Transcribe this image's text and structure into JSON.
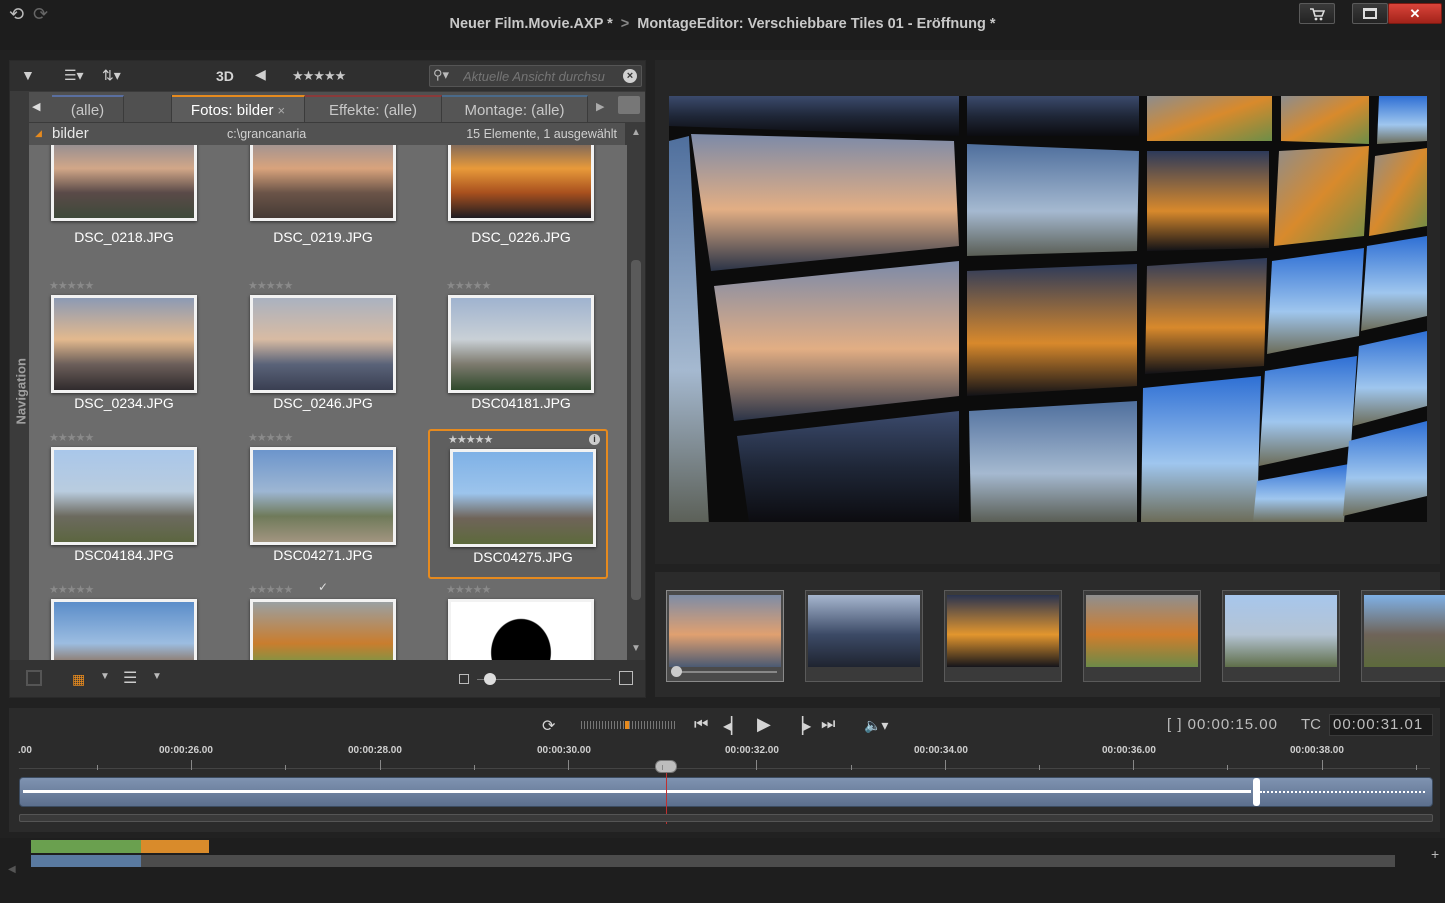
{
  "window": {
    "project": "Neuer Film.Movie.AXP *",
    "separator": ">",
    "editor": "MontageEditor: Verschiebbare Tiles  01 - Eröffnung *"
  },
  "library": {
    "toolbar": {
      "label_3d": "3D",
      "rating_filter": "★★★★★"
    },
    "search": {
      "placeholder": "Aktuelle Ansicht durchsu"
    },
    "tabs": [
      "(alle)",
      "Fotos: bilder",
      "Effekte: (alle)",
      "Montage: (alle)"
    ],
    "active_tab_close": "×",
    "breadcrumb": {
      "name": "bilder",
      "path": "c:\\grancanaria",
      "count": "15 Elemente, 1 ausgewählt"
    },
    "navigation_label": "Navigation",
    "items": [
      {
        "name": "DSC_0218.JPG",
        "colors": [
          "#6f7f98",
          "#d2a788",
          "#5a4a48",
          "#3e4a3a"
        ]
      },
      {
        "name": "DSC_0219.JPG",
        "colors": [
          "#7f8aa0",
          "#d9a37c",
          "#6b5448",
          "#453a35"
        ]
      },
      {
        "name": "DSC_0226.JPG",
        "colors": [
          "#3b4a70",
          "#e89a3a",
          "#a8501e",
          "#1e1c22"
        ]
      },
      {
        "name": "DSC_0234.JPG",
        "colors": [
          "#8c9ab4",
          "#e3b98e",
          "#6c5f5a",
          "#302b2d"
        ]
      },
      {
        "name": "DSC_0246.JPG",
        "colors": [
          "#aab2c0",
          "#d8bba3",
          "#5a6379",
          "#3a3f52"
        ]
      },
      {
        "name": "DSC04181.JPG",
        "colors": [
          "#9fb3cf",
          "#c9d0d6",
          "#7d7a6e",
          "#2f4a2c"
        ]
      },
      {
        "name": "DSC04184.JPG",
        "colors": [
          "#a9c7ea",
          "#b9ccdf",
          "#6c6a5f",
          "#5c6640"
        ]
      },
      {
        "name": "DSC04271.JPG",
        "colors": [
          "#6c95cc",
          "#9db6d3",
          "#6f7a5a",
          "#a29580"
        ]
      },
      {
        "name": "DSC04275.JPG",
        "colors": [
          "#7fb1e6",
          "#9cc4ec",
          "#6f6459",
          "#5d6a3c"
        ]
      },
      {
        "name": "",
        "colors": [
          "#5b8dc9",
          "#9cbde1",
          "#8a6548",
          "#6b4a35"
        ]
      },
      {
        "name": "",
        "colors": [
          "#9aa0a2",
          "#c97d2e",
          "#6c9a4a",
          "#b8b8b8"
        ]
      },
      {
        "name": "",
        "colors": [
          "#ffffff",
          "#ffffff",
          "#000000",
          "#000000"
        ]
      }
    ],
    "selected_index": 8,
    "checked_index": 10
  },
  "strip": {
    "tiles": [
      [
        "#7e8ca6",
        "#e0a070",
        "#4b5a73"
      ],
      [
        "#a6b6cf",
        "#3c4a66",
        "#1f2430"
      ],
      [
        "#2a3450",
        "#e2962e",
        "#15151b"
      ],
      [
        "#8f8f8f",
        "#d07d2c",
        "#6d8a48"
      ],
      [
        "#a7c6ec",
        "#b4c4d4",
        "#5f6e4a"
      ],
      [
        "#7fb1e6",
        "#6f6459",
        "#5d6a3c"
      ]
    ]
  },
  "transport": {
    "timecode_duration": "[ ] 00:00:15.00",
    "tc_label": "TC",
    "timecode_position": "00:00:31.01",
    "ruler": [
      ".00",
      "00:00:26.00",
      "00:00:28.00",
      "00:00:30.00",
      "00:00:32.00",
      "00:00:34.00",
      "00:00:36.00",
      "00:00:38.00"
    ]
  },
  "colors": {
    "accent": "#e68a1e",
    "track": "#6f83a2",
    "green": "#6aa04f",
    "orange": "#d98b2b",
    "blue": "#5a7aa0"
  }
}
